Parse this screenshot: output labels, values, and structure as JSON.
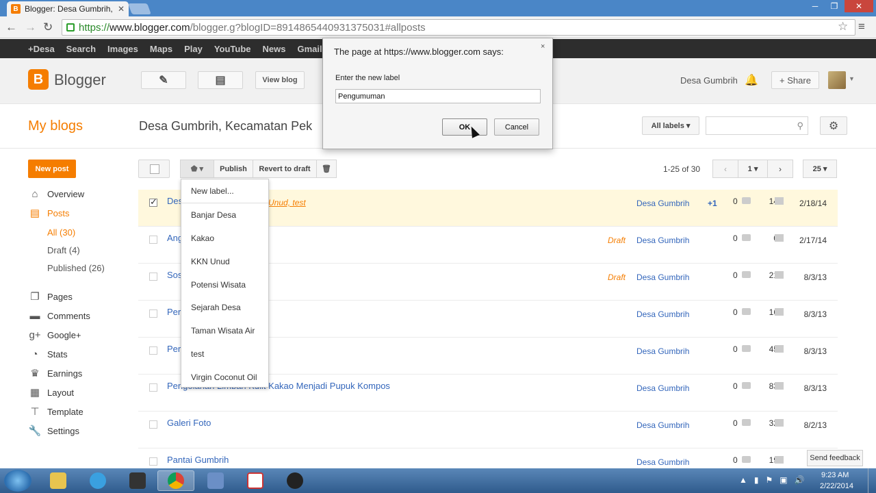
{
  "browser": {
    "tab_title": "Blogger: Desa Gumbrih, K",
    "favicon": "B",
    "url_scheme": "https://",
    "url_host": "www.blogger.com",
    "url_path": "/blogger.g?blogID=8914865440931375031#allposts",
    "win_min": "─",
    "win_max": "❐",
    "win_close": "✕",
    "back": "←",
    "forward": "→",
    "reload": "↻",
    "star": "☆",
    "menu": "≡"
  },
  "google_bar": [
    "+Desa",
    "Search",
    "Images",
    "Maps",
    "Play",
    "YouTube",
    "News",
    "Gmail"
  ],
  "header": {
    "logo_letter": "B",
    "logo_text": "Blogger",
    "view_blog": "View blog",
    "user_name": "Desa Gumbrih",
    "share": "+ Share"
  },
  "blogbar": {
    "my_blogs": "My blogs",
    "blog_title": "Desa Gumbrih, Kecamatan Pek",
    "all_labels": "All labels ▾"
  },
  "sidebar": {
    "new_post": "New post",
    "items": [
      {
        "label": "Overview",
        "icon": "home-icon"
      },
      {
        "label": "Posts",
        "icon": "posts-icon"
      },
      {
        "label": "Pages",
        "icon": "pages-icon"
      },
      {
        "label": "Comments",
        "icon": "comments-icon"
      },
      {
        "label": "Google+",
        "icon": "googleplus-icon"
      },
      {
        "label": "Stats",
        "icon": "stats-icon"
      },
      {
        "label": "Earnings",
        "icon": "trophy-icon"
      },
      {
        "label": "Layout",
        "icon": "layout-icon"
      },
      {
        "label": "Template",
        "icon": "template-icon"
      },
      {
        "label": "Settings",
        "icon": "wrench-icon"
      }
    ],
    "subitems": [
      "All (30)",
      "Draft (4)",
      "Published (26)"
    ]
  },
  "actions": {
    "label_caret": "▾",
    "publish": "Publish",
    "revert": "Revert to draft",
    "range": "1-25 of 30",
    "page": "1 ▾",
    "per_page": "25 ▾"
  },
  "posts": [
    {
      "title": "Des",
      "labels": "Unud, test",
      "draft": "",
      "author": "Desa Gumbrih",
      "plus": "+1",
      "comments": "0",
      "views": "14",
      "date": "2/18/14"
    },
    {
      "title": "Ang                                           e 8",
      "labels": "",
      "draft": "Draft",
      "author": "Desa Gumbrih",
      "plus": "",
      "comments": "0",
      "views": "0",
      "date": "2/17/14"
    },
    {
      "title": "Sos                                    Penyakit",
      "labels": "",
      "draft": "Draft",
      "author": "Desa Gumbrih",
      "plus": "",
      "comments": "0",
      "views": "21",
      "date": "8/3/13"
    },
    {
      "title": "Per",
      "labels": "",
      "draft": "",
      "author": "Desa Gumbrih",
      "plus": "",
      "comments": "0",
      "views": "16",
      "date": "8/3/13"
    },
    {
      "title": "Per                                          Air",
      "labels": "",
      "draft": "",
      "author": "Desa Gumbrih",
      "plus": "",
      "comments": "0",
      "views": "45",
      "date": "8/3/13"
    },
    {
      "title": "Pengolahan Limbah Kulit Kakao Menjadi Pupuk Kompos",
      "labels": "",
      "draft": "",
      "author": "Desa Gumbrih",
      "plus": "",
      "comments": "0",
      "views": "83",
      "date": "8/3/13"
    },
    {
      "title": "Galeri Foto",
      "labels": "",
      "draft": "",
      "author": "Desa Gumbrih",
      "plus": "",
      "comments": "0",
      "views": "32",
      "date": "8/2/13"
    },
    {
      "title": "Pantai Gumbrih",
      "labels": "",
      "draft": "",
      "author": "Desa Gumbrih",
      "plus": "",
      "comments": "0",
      "views": "19",
      "date": "8"
    }
  ],
  "label_menu": {
    "new_label": "New label...",
    "labels": [
      "Banjar Desa",
      "Kakao",
      "KKN Unud",
      "Potensi Wisata",
      "Sejarah Desa",
      "Taman Wisata Air",
      "test",
      "Virgin Coconut Oil"
    ]
  },
  "dialog": {
    "title": "The page at https://www.blogger.com says:",
    "close": "×",
    "message": "Enter the new label",
    "value": "Pengumuman",
    "ok": "OK",
    "cancel": "Cancel"
  },
  "feedback": "Send feedback",
  "taskbar": {
    "time": "9:23 AM",
    "date": "2/22/2014",
    "tray": [
      "▲",
      "▮",
      "⚑",
      "▣",
      "🔊"
    ]
  },
  "colors": {
    "accent": "#f57d00",
    "link": "#3366bb"
  }
}
